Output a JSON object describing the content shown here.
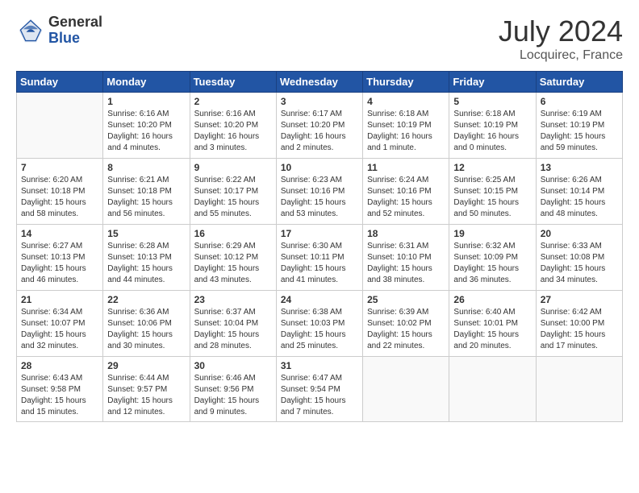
{
  "header": {
    "logo_general": "General",
    "logo_blue": "Blue",
    "title_month": "July 2024",
    "title_location": "Locquirec, France"
  },
  "days_of_week": [
    "Sunday",
    "Monday",
    "Tuesday",
    "Wednesday",
    "Thursday",
    "Friday",
    "Saturday"
  ],
  "weeks": [
    [
      {
        "day": "",
        "info": ""
      },
      {
        "day": "1",
        "info": "Sunrise: 6:16 AM\nSunset: 10:20 PM\nDaylight: 16 hours\nand 4 minutes."
      },
      {
        "day": "2",
        "info": "Sunrise: 6:16 AM\nSunset: 10:20 PM\nDaylight: 16 hours\nand 3 minutes."
      },
      {
        "day": "3",
        "info": "Sunrise: 6:17 AM\nSunset: 10:20 PM\nDaylight: 16 hours\nand 2 minutes."
      },
      {
        "day": "4",
        "info": "Sunrise: 6:18 AM\nSunset: 10:19 PM\nDaylight: 16 hours\nand 1 minute."
      },
      {
        "day": "5",
        "info": "Sunrise: 6:18 AM\nSunset: 10:19 PM\nDaylight: 16 hours\nand 0 minutes."
      },
      {
        "day": "6",
        "info": "Sunrise: 6:19 AM\nSunset: 10:19 PM\nDaylight: 15 hours\nand 59 minutes."
      }
    ],
    [
      {
        "day": "7",
        "info": "Sunrise: 6:20 AM\nSunset: 10:18 PM\nDaylight: 15 hours\nand 58 minutes."
      },
      {
        "day": "8",
        "info": "Sunrise: 6:21 AM\nSunset: 10:18 PM\nDaylight: 15 hours\nand 56 minutes."
      },
      {
        "day": "9",
        "info": "Sunrise: 6:22 AM\nSunset: 10:17 PM\nDaylight: 15 hours\nand 55 minutes."
      },
      {
        "day": "10",
        "info": "Sunrise: 6:23 AM\nSunset: 10:16 PM\nDaylight: 15 hours\nand 53 minutes."
      },
      {
        "day": "11",
        "info": "Sunrise: 6:24 AM\nSunset: 10:16 PM\nDaylight: 15 hours\nand 52 minutes."
      },
      {
        "day": "12",
        "info": "Sunrise: 6:25 AM\nSunset: 10:15 PM\nDaylight: 15 hours\nand 50 minutes."
      },
      {
        "day": "13",
        "info": "Sunrise: 6:26 AM\nSunset: 10:14 PM\nDaylight: 15 hours\nand 48 minutes."
      }
    ],
    [
      {
        "day": "14",
        "info": "Sunrise: 6:27 AM\nSunset: 10:13 PM\nDaylight: 15 hours\nand 46 minutes."
      },
      {
        "day": "15",
        "info": "Sunrise: 6:28 AM\nSunset: 10:13 PM\nDaylight: 15 hours\nand 44 minutes."
      },
      {
        "day": "16",
        "info": "Sunrise: 6:29 AM\nSunset: 10:12 PM\nDaylight: 15 hours\nand 43 minutes."
      },
      {
        "day": "17",
        "info": "Sunrise: 6:30 AM\nSunset: 10:11 PM\nDaylight: 15 hours\nand 41 minutes."
      },
      {
        "day": "18",
        "info": "Sunrise: 6:31 AM\nSunset: 10:10 PM\nDaylight: 15 hours\nand 38 minutes."
      },
      {
        "day": "19",
        "info": "Sunrise: 6:32 AM\nSunset: 10:09 PM\nDaylight: 15 hours\nand 36 minutes."
      },
      {
        "day": "20",
        "info": "Sunrise: 6:33 AM\nSunset: 10:08 PM\nDaylight: 15 hours\nand 34 minutes."
      }
    ],
    [
      {
        "day": "21",
        "info": "Sunrise: 6:34 AM\nSunset: 10:07 PM\nDaylight: 15 hours\nand 32 minutes."
      },
      {
        "day": "22",
        "info": "Sunrise: 6:36 AM\nSunset: 10:06 PM\nDaylight: 15 hours\nand 30 minutes."
      },
      {
        "day": "23",
        "info": "Sunrise: 6:37 AM\nSunset: 10:04 PM\nDaylight: 15 hours\nand 28 minutes."
      },
      {
        "day": "24",
        "info": "Sunrise: 6:38 AM\nSunset: 10:03 PM\nDaylight: 15 hours\nand 25 minutes."
      },
      {
        "day": "25",
        "info": "Sunrise: 6:39 AM\nSunset: 10:02 PM\nDaylight: 15 hours\nand 22 minutes."
      },
      {
        "day": "26",
        "info": "Sunrise: 6:40 AM\nSunset: 10:01 PM\nDaylight: 15 hours\nand 20 minutes."
      },
      {
        "day": "27",
        "info": "Sunrise: 6:42 AM\nSunset: 10:00 PM\nDaylight: 15 hours\nand 17 minutes."
      }
    ],
    [
      {
        "day": "28",
        "info": "Sunrise: 6:43 AM\nSunset: 9:58 PM\nDaylight: 15 hours\nand 15 minutes."
      },
      {
        "day": "29",
        "info": "Sunrise: 6:44 AM\nSunset: 9:57 PM\nDaylight: 15 hours\nand 12 minutes."
      },
      {
        "day": "30",
        "info": "Sunrise: 6:46 AM\nSunset: 9:56 PM\nDaylight: 15 hours\nand 9 minutes."
      },
      {
        "day": "31",
        "info": "Sunrise: 6:47 AM\nSunset: 9:54 PM\nDaylight: 15 hours\nand 7 minutes."
      },
      {
        "day": "",
        "info": ""
      },
      {
        "day": "",
        "info": ""
      },
      {
        "day": "",
        "info": ""
      }
    ]
  ]
}
